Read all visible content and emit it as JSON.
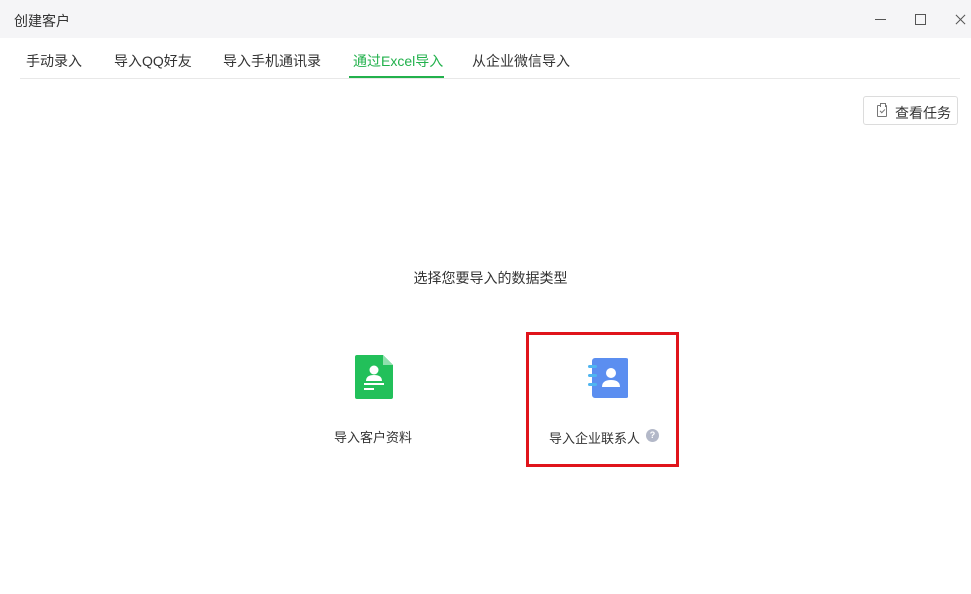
{
  "window": {
    "title": "创建客户",
    "minimize_icon": "minimize-icon",
    "maximize_icon": "maximize-icon",
    "close_icon": "close-icon"
  },
  "tabs": [
    {
      "label": "手动录入",
      "active": false
    },
    {
      "label": "导入QQ好友",
      "active": false
    },
    {
      "label": "导入手机通讯录",
      "active": false
    },
    {
      "label": "通过Excel导入",
      "active": true
    },
    {
      "label": "从企业微信导入",
      "active": false
    }
  ],
  "toolbar": {
    "view_tasks_label": "查看任务",
    "view_tasks_icon": "clipboard-check-icon"
  },
  "main": {
    "prompt": "选择您要导入的数据类型",
    "options": [
      {
        "label": "导入客户资料",
        "icon": "customer-doc-icon",
        "icon_color": "#22c05a"
      },
      {
        "label": "导入企业联系人",
        "icon": "contact-book-icon",
        "icon_color": "#5b8ef0",
        "help_icon": "help-icon",
        "help_text": "?",
        "highlighted": true
      }
    ]
  },
  "colors": {
    "accent": "#22b14c",
    "highlight_border": "#e0141b"
  }
}
